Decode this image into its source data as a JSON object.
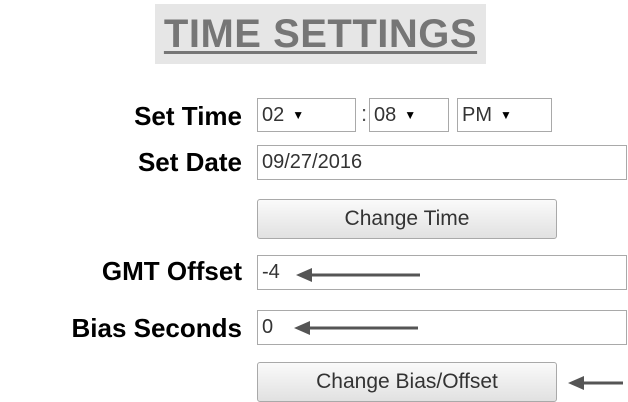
{
  "title": "TIME SETTINGS",
  "set_time": {
    "label": "Set Time",
    "hour": "02",
    "minute": "08",
    "separator": ":",
    "ampm": "PM"
  },
  "set_date": {
    "label": "Set Date",
    "value": "09/27/2016"
  },
  "change_time_button": "Change Time",
  "gmt_offset": {
    "label": "GMT Offset",
    "value": "-4"
  },
  "bias_seconds": {
    "label": "Bias Seconds",
    "value": "0"
  },
  "change_bias_offset_button": "Change Bias/Offset",
  "icons": {
    "dropdown": "triangle-down",
    "annotation_arrow": "left-arrow"
  },
  "colors": {
    "title_text": "#767676",
    "title_bg": "#e6e6e6",
    "arrow": "#555555"
  }
}
